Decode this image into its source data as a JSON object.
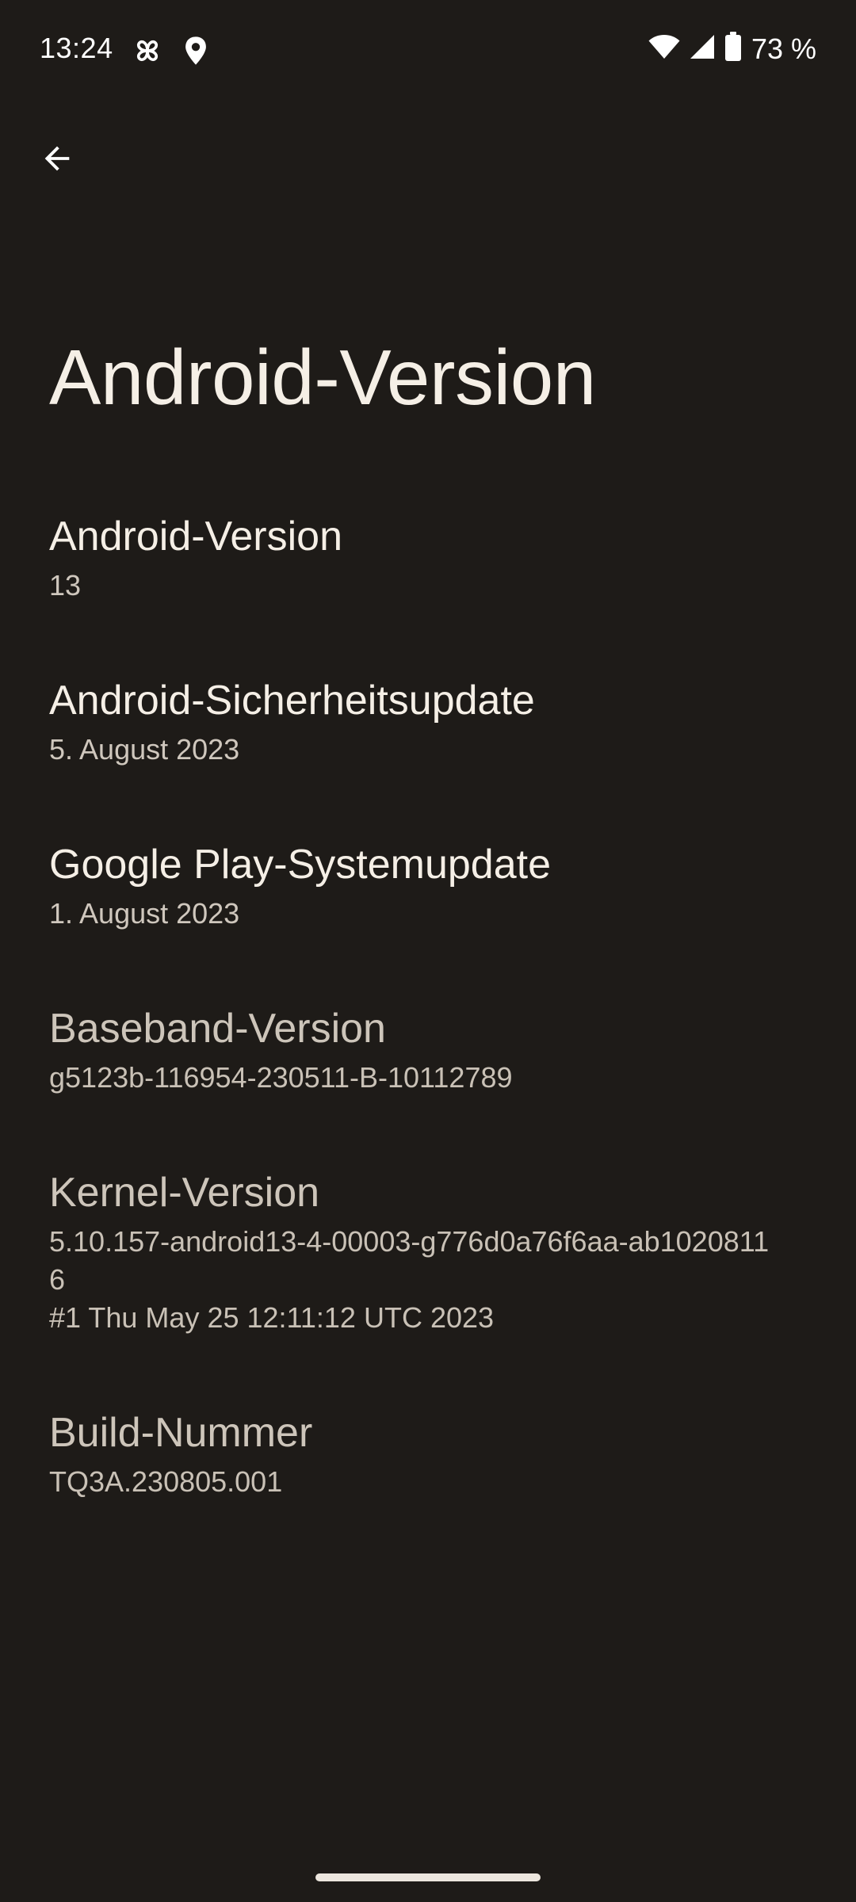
{
  "status_bar": {
    "time": "13:24",
    "left_icons": [
      "pinwheel-icon",
      "location-icon"
    ],
    "right_icons": [
      "wifi-icon",
      "cell-signal-icon",
      "battery-icon"
    ],
    "battery": "73 %"
  },
  "nav": {
    "back_icon": "arrow-back-icon"
  },
  "page": {
    "title": "Android-Version"
  },
  "items": [
    {
      "title": "Android-Version",
      "summary": "13"
    },
    {
      "title": "Android-Sicherheitsupdate",
      "summary": "5. August 2023"
    },
    {
      "title": "Google Play-Systemupdate",
      "summary": "1. August 2023"
    },
    {
      "title": "Baseband-Version",
      "summary": "g5123b-116954-230511-B-10112789"
    },
    {
      "title": "Kernel-Version",
      "summary": "5.10.157-android13-4-00003-g776d0a76f6aa-ab1020811\n6\n#1 Thu May 25 12:11:12 UTC 2023"
    },
    {
      "title": "Build-Nummer",
      "summary": "TQ3A.230805.001"
    }
  ],
  "colors": {
    "background": "#1e1b18",
    "text_primary": "#f5efe6",
    "text_secondary": "#cfc7bd"
  }
}
